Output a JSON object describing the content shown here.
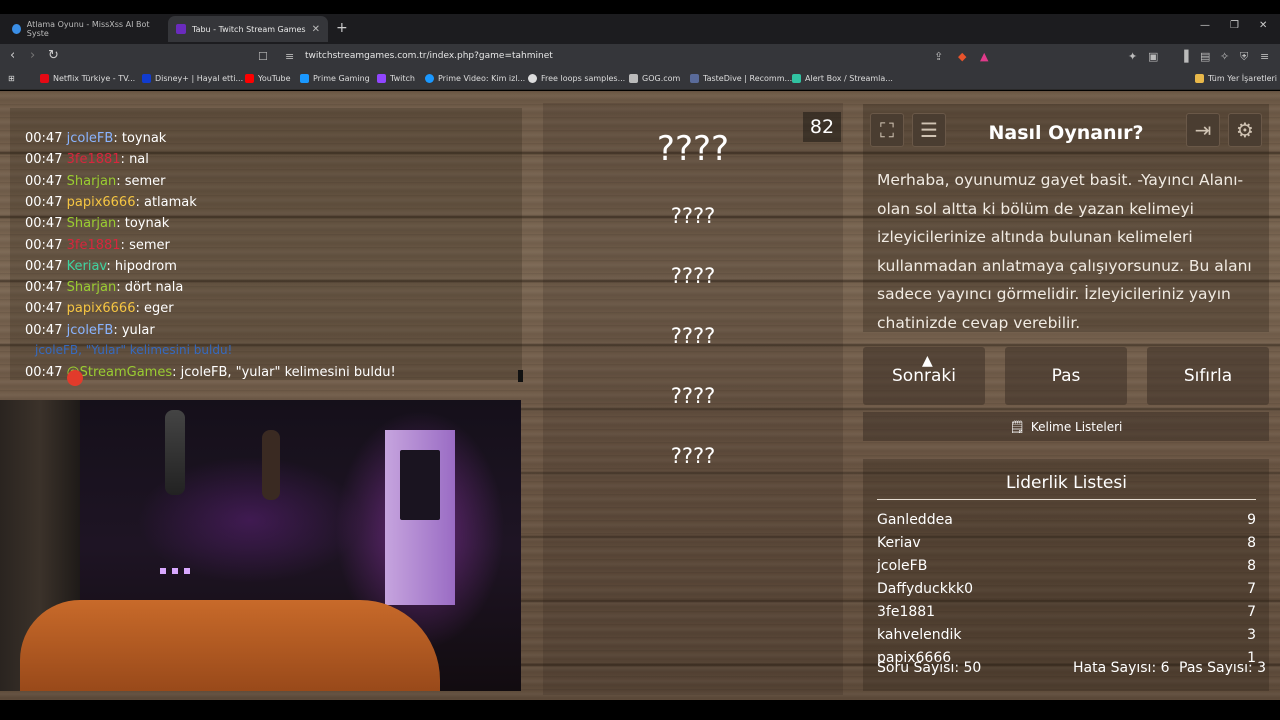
{
  "browser": {
    "tabs": [
      {
        "title": "Atlama Oyunu - MissXss AI Bot Syste"
      },
      {
        "title": "Tabu - Twitch Stream Games"
      }
    ],
    "url": "twitchstreamgames.com.tr/index.php?game=tahminet",
    "bookmarks": [
      "Netflix Türkiye - TV...",
      "Disney+ | Hayal etti...",
      "YouTube",
      "Prime Gaming",
      "Twitch",
      "Prime Video: Kim izl...",
      "Free loops samples...",
      "GOG.com",
      "TasteDive | Recomm...",
      "Alert Box / Streamla...",
      "Tüm Yer İşaretleri"
    ]
  },
  "chat": {
    "messages": [
      {
        "time": "00:47",
        "user": "jcoleFB",
        "color": "#8ab4ff",
        "text": "toynak"
      },
      {
        "time": "00:47",
        "user": "3fe1881",
        "color": "#d7263d",
        "text": "nal"
      },
      {
        "time": "00:47",
        "user": "Sharjan",
        "color": "#9acd32",
        "text": "semer"
      },
      {
        "time": "00:47",
        "user": "papix6666",
        "color": "#f5c542",
        "text": "atlamak"
      },
      {
        "time": "00:47",
        "user": "Sharjan",
        "color": "#9acd32",
        "text": "toynak"
      },
      {
        "time": "00:47",
        "user": "3fe1881",
        "color": "#d7263d",
        "text": "semer"
      },
      {
        "time": "00:47",
        "user": "Keriav",
        "color": "#3fd3a0",
        "text": "hipodrom"
      },
      {
        "time": "00:47",
        "user": "Sharjan",
        "color": "#9acd32",
        "text": "dört nala"
      },
      {
        "time": "00:47",
        "user": "papix6666",
        "color": "#f5c542",
        "text": "eger"
      },
      {
        "time": "00:47",
        "user": "jcoleFB",
        "color": "#8ab4ff",
        "text": "yular"
      },
      {
        "time": "00:47",
        "user": "@StreamGames",
        "color": "#9acd32",
        "text": "jcoleFB, \"yular\" kelimesini buldu!"
      }
    ],
    "found_notice": "jcoleFB, \"Yular\" kelimesini buldu!"
  },
  "words": {
    "counter": "82",
    "main": "????",
    "forbidden": [
      "????",
      "????",
      "????",
      "????",
      "????"
    ]
  },
  "howto": {
    "title": "Nasıl Oynanır?",
    "text": "Merhaba, oyunumuz gayet basit. -Yayıncı Alanı- olan sol altta ki bölüm de yazan kelimeyi izleyicilerinize altında bulunan kelimeleri kullanmadan anlatmaya çalışıyorsunuz. Bu alanı sadece yayıncı görmelidir. İzleyicileriniz yayın chatinizde cevap verebilir."
  },
  "controls": {
    "next": "Sonraki",
    "pass": "Pas",
    "reset": "Sıfırla",
    "word_lists": "Kelime Listeleri"
  },
  "leaderboard": {
    "title": "Liderlik Listesi",
    "rows": [
      {
        "name": "Ganleddea",
        "score": "9"
      },
      {
        "name": "Keriav",
        "score": "8"
      },
      {
        "name": "jcoleFB",
        "score": "8"
      },
      {
        "name": "Daffyduckkk0",
        "score": "7"
      },
      {
        "name": "3fe1881",
        "score": "7"
      },
      {
        "name": "kahvelendik",
        "score": "3"
      },
      {
        "name": "papix6666",
        "score": "1"
      }
    ]
  },
  "stats": {
    "questions": "Soru Sayısı: 50",
    "errors": "Hata Sayısı: 6",
    "passes": "Pas Sayısı: 3"
  }
}
